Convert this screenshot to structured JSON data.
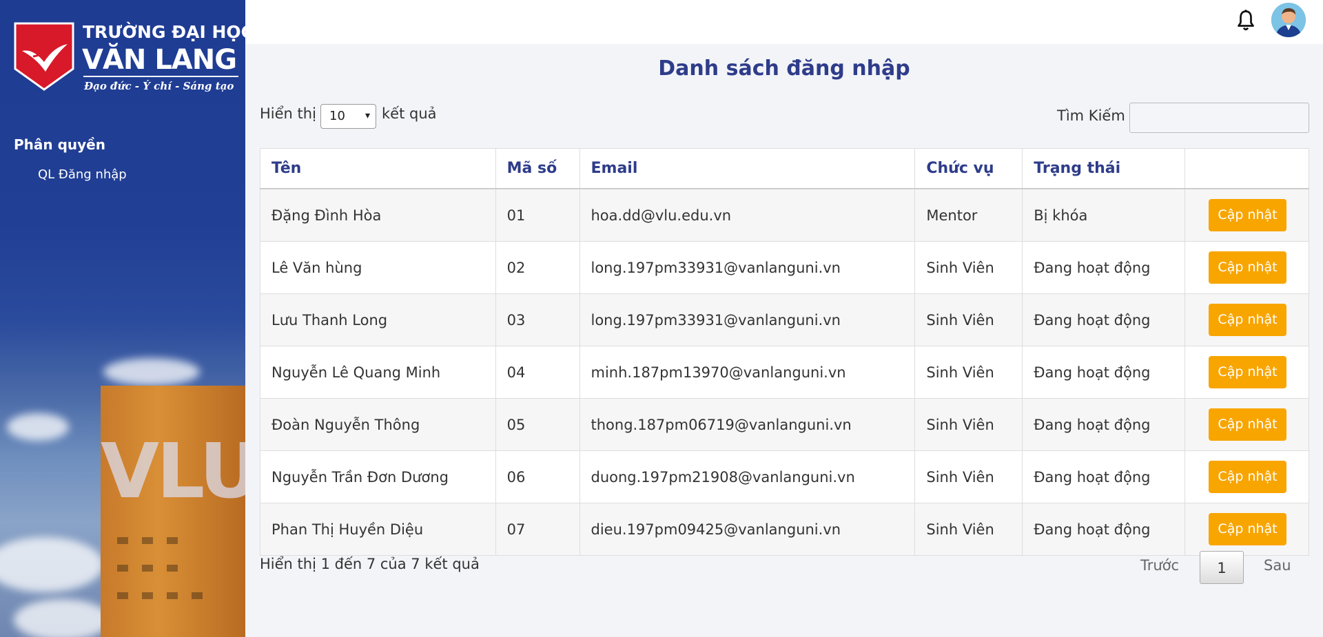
{
  "brand": {
    "line1": "TRƯỜNG ĐẠI HỌC",
    "line2": "VĂN LANG",
    "tagline": "Đạo đức - Ý chí - Sáng tạo",
    "building_text": "VLU"
  },
  "sidebar": {
    "section": "Phân quyền",
    "items": [
      {
        "label": "QL Đăng nhập"
      }
    ]
  },
  "topbar": {
    "bell_icon": "bell-icon",
    "avatar_icon": "user-avatar"
  },
  "page": {
    "title": "Danh sách đăng nhập"
  },
  "controls": {
    "show_label": "Hiển thị",
    "page_size": "10",
    "after_label": "kết quả",
    "search_label": "Tìm Kiếm"
  },
  "table": {
    "headers": [
      "Tên",
      "Mã số",
      "Email",
      "Chức vụ",
      "Trạng thái",
      ""
    ],
    "rows": [
      {
        "name": "Đặng Đình Hòa",
        "code": "01",
        "email": "hoa.dd@vlu.edu.vn",
        "role": "Mentor",
        "status": "Bị khóa",
        "action": "Cập nhật"
      },
      {
        "name": "Lê Văn hùng",
        "code": "02",
        "email": "long.197pm33931@vanlanguni.vn",
        "role": "Sinh Viên",
        "status": "Đang hoạt động",
        "action": "Cập nhật"
      },
      {
        "name": "Lưu Thanh Long",
        "code": "03",
        "email": "long.197pm33931@vanlanguni.vn",
        "role": "Sinh Viên",
        "status": "Đang hoạt động",
        "action": "Cập nhật"
      },
      {
        "name": "Nguyễn Lê Quang Minh",
        "code": "04",
        "email": "minh.187pm13970@vanlanguni.vn",
        "role": "Sinh Viên",
        "status": "Đang hoạt động",
        "action": "Cập nhật"
      },
      {
        "name": "Đoàn Nguyễn Thông",
        "code": "05",
        "email": "thong.187pm06719@vanlanguni.vn",
        "role": "Sinh Viên",
        "status": "Đang hoạt động",
        "action": "Cập nhật"
      },
      {
        "name": "Nguyễn Trần Đơn Dương",
        "code": "06",
        "email": "duong.197pm21908@vanlanguni.vn",
        "role": "Sinh Viên",
        "status": "Đang hoạt động",
        "action": "Cập nhật"
      },
      {
        "name": "Phan Thị Huyền Diệu",
        "code": "07",
        "email": "dieu.197pm09425@vanlanguni.vn",
        "role": "Sinh Viên",
        "status": "Đang hoạt động",
        "action": "Cập nhật"
      }
    ]
  },
  "footer": {
    "info": "Hiển thị 1 đến 7 của 7 kết quả",
    "prev": "Trước",
    "page": "1",
    "next": "Sau"
  },
  "colors": {
    "accent": "#2e3c8a",
    "button": "#f8a500",
    "sidebar": "#1f3c93"
  }
}
